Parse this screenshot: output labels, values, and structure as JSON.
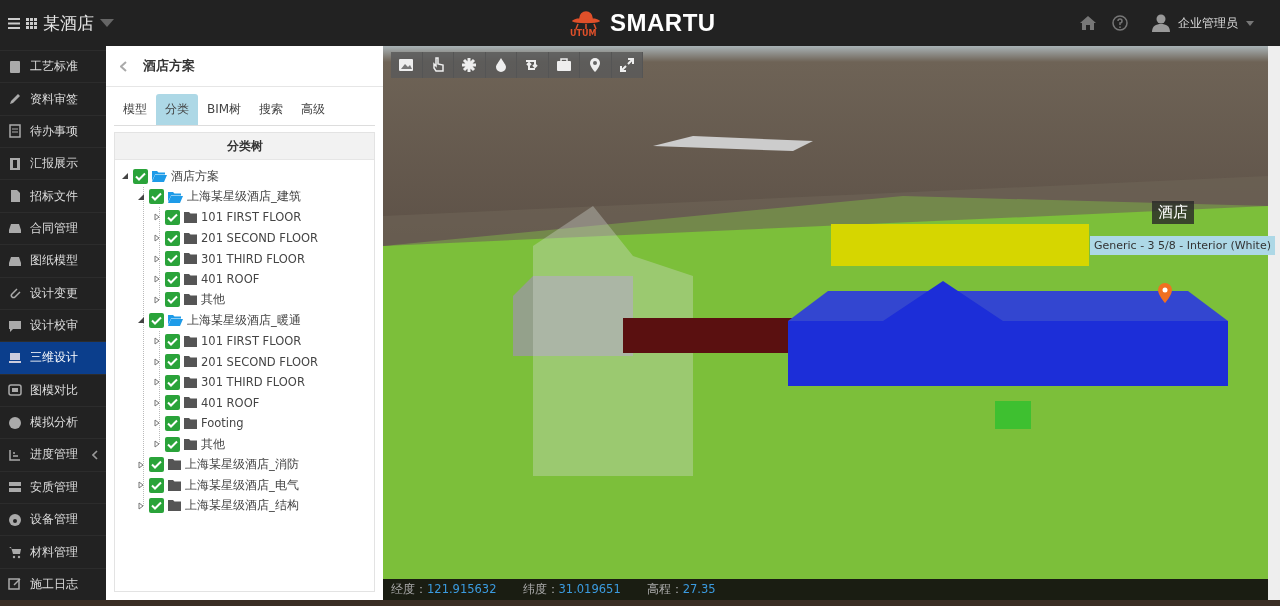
{
  "header": {
    "project": "某酒店",
    "logo_text": "SMARTU",
    "logo_sub": "UTUM",
    "user": "企业管理员"
  },
  "sidebar": {
    "items": [
      {
        "label": "工艺标准",
        "selected": false
      },
      {
        "label": "资料审签",
        "selected": false
      },
      {
        "label": "待办事项",
        "selected": false
      },
      {
        "label": "汇报展示",
        "selected": false
      },
      {
        "label": "招标文件",
        "selected": false
      },
      {
        "label": "合同管理",
        "selected": false
      },
      {
        "label": "图纸模型",
        "selected": false
      },
      {
        "label": "设计变更",
        "selected": false
      },
      {
        "label": "设计校审",
        "selected": false
      },
      {
        "label": "三维设计",
        "selected": true
      },
      {
        "label": "图模对比",
        "selected": false
      },
      {
        "label": "模拟分析",
        "selected": false
      },
      {
        "label": "进度管理",
        "selected": false,
        "submenu": true
      },
      {
        "label": "安质管理",
        "selected": false
      },
      {
        "label": "设备管理",
        "selected": false
      },
      {
        "label": "材料管理",
        "selected": false
      },
      {
        "label": "施工日志",
        "selected": false
      }
    ]
  },
  "panel": {
    "title": "酒店方案",
    "tabs": [
      {
        "label": "模型",
        "selected": false
      },
      {
        "label": "分类",
        "selected": true
      },
      {
        "label": "BIM树",
        "selected": false
      },
      {
        "label": "搜索",
        "selected": false
      },
      {
        "label": "高级",
        "selected": false
      }
    ],
    "tree_title": "分类树",
    "tree": [
      {
        "label": "酒店方案",
        "checked": true,
        "expanded": true,
        "children": [
          {
            "label": "上海某星级酒店_建筑",
            "checked": true,
            "expanded": true,
            "children": [
              {
                "label": "101 FIRST FLOOR",
                "checked": true,
                "expanded": false
              },
              {
                "label": "201 SECOND FLOOR",
                "checked": true,
                "expanded": false
              },
              {
                "label": "301 THIRD FLOOR",
                "checked": true,
                "expanded": false
              },
              {
                "label": "401 ROOF",
                "checked": true,
                "expanded": false
              },
              {
                "label": "其他",
                "checked": true,
                "expanded": false
              }
            ]
          },
          {
            "label": "上海某星级酒店_暖通",
            "checked": true,
            "expanded": true,
            "children": [
              {
                "label": "101 FIRST FLOOR",
                "checked": true,
                "expanded": false
              },
              {
                "label": "201 SECOND FLOOR",
                "checked": true,
                "expanded": false
              },
              {
                "label": "301 THIRD FLOOR",
                "checked": true,
                "expanded": false
              },
              {
                "label": "401 ROOF",
                "checked": true,
                "expanded": false
              },
              {
                "label": "Footing",
                "checked": true,
                "expanded": false
              },
              {
                "label": "其他",
                "checked": true,
                "expanded": false
              }
            ]
          },
          {
            "label": "上海某星级酒店_消防",
            "checked": true,
            "expanded": false
          },
          {
            "label": "上海某星级酒店_电气",
            "checked": true,
            "expanded": false
          },
          {
            "label": "上海某星级酒店_结构",
            "checked": true,
            "expanded": false
          }
        ]
      }
    ]
  },
  "viewer": {
    "label": "酒店",
    "tooltip": "Generic - 3 5/8 - Interior (White)",
    "status": [
      {
        "label": "经度：",
        "value": "121.915632"
      },
      {
        "label": "纬度：",
        "value": "31.019651"
      },
      {
        "label": "高程：",
        "value": "27.35"
      }
    ]
  }
}
